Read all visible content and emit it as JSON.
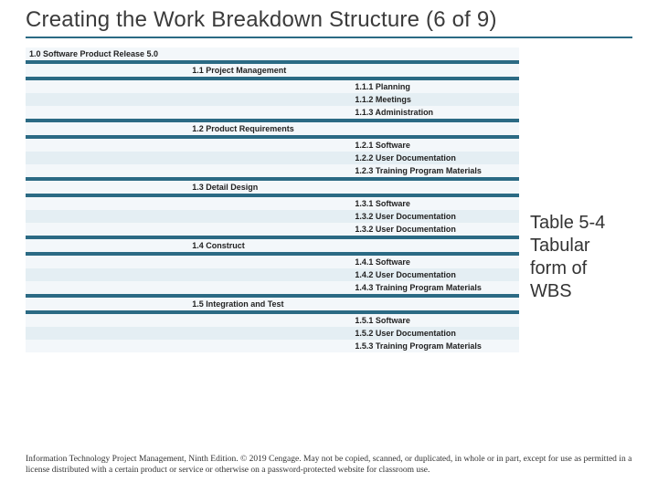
{
  "title": "Creating the Work Breakdown Structure (6 of 9)",
  "caption": {
    "line1": "Table 5-4",
    "line2": "Tabular",
    "line3": "form of",
    "line4": "WBS"
  },
  "rows": [
    {
      "z": "l",
      "c1": "1.0 Software Product Release 5.0",
      "c2": "",
      "c3": ""
    },
    {
      "header": true
    },
    {
      "z": "l",
      "c1": "",
      "c2": "1.1 Project Management",
      "c3": ""
    },
    {
      "header": true
    },
    {
      "z": "l",
      "c1": "",
      "c2": "",
      "c3": "1.1.1 Planning"
    },
    {
      "z": "d",
      "c1": "",
      "c2": "",
      "c3": "1.1.2 Meetings"
    },
    {
      "z": "l",
      "c1": "",
      "c2": "",
      "c3": "1.1.3 Administration"
    },
    {
      "header": true
    },
    {
      "z": "l",
      "c1": "",
      "c2": "1.2 Product Requirements",
      "c3": ""
    },
    {
      "header": true
    },
    {
      "z": "l",
      "c1": "",
      "c2": "",
      "c3": "1.2.1 Software"
    },
    {
      "z": "d",
      "c1": "",
      "c2": "",
      "c3": "1.2.2 User Documentation"
    },
    {
      "z": "l",
      "c1": "",
      "c2": "",
      "c3": "1.2.3 Training Program Materials"
    },
    {
      "header": true
    },
    {
      "z": "l",
      "c1": "",
      "c2": "1.3 Detail Design",
      "c3": ""
    },
    {
      "header": true
    },
    {
      "z": "l",
      "c1": "",
      "c2": "",
      "c3": "1.3.1 Software"
    },
    {
      "z": "d",
      "c1": "",
      "c2": "",
      "c3": "1.3.2 User Documentation"
    },
    {
      "z": "l",
      "c1": "",
      "c2": "",
      "c3": "1.3.2 User Documentation"
    },
    {
      "header": true
    },
    {
      "z": "l",
      "c1": "",
      "c2": "1.4 Construct",
      "c3": ""
    },
    {
      "header": true
    },
    {
      "z": "l",
      "c1": "",
      "c2": "",
      "c3": "1.4.1 Software"
    },
    {
      "z": "d",
      "c1": "",
      "c2": "",
      "c3": "1.4.2 User Documentation"
    },
    {
      "z": "l",
      "c1": "",
      "c2": "",
      "c3": "1.4.3 Training Program Materials"
    },
    {
      "header": true
    },
    {
      "z": "l",
      "c1": "",
      "c2": "1.5 Integration and Test",
      "c3": ""
    },
    {
      "header": true
    },
    {
      "z": "l",
      "c1": "",
      "c2": "",
      "c3": "1.5.1 Software"
    },
    {
      "z": "d",
      "c1": "",
      "c2": "",
      "c3": "1.5.2 User Documentation"
    },
    {
      "z": "l",
      "c1": "",
      "c2": "",
      "c3": "1.5.3 Training Program Materials"
    }
  ],
  "footnote": "Information Technology Project Management, Ninth Edition. © 2019 Cengage. May not be copied, scanned, or duplicated, in whole or in part, except for use as permitted in a license distributed with a certain product or service or otherwise on a password-protected website for classroom use."
}
